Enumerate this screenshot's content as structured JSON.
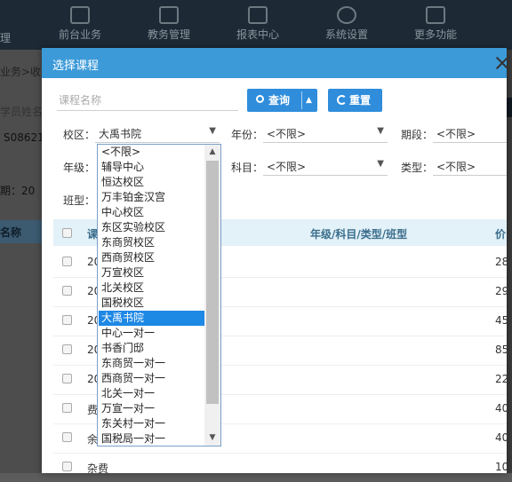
{
  "nav": {
    "left_partial": "理",
    "items": [
      {
        "label": "前台业务",
        "icon": "monitor-icon"
      },
      {
        "label": "教务管理",
        "icon": "archive-icon"
      },
      {
        "label": "报表中心",
        "icon": "chart-icon"
      },
      {
        "label": "系统设置",
        "icon": "gear-icon"
      },
      {
        "label": "更多功能",
        "icon": "grid-icon"
      }
    ]
  },
  "background": {
    "breadcrumb": "业务>收",
    "search_hint": "学员姓名",
    "code": "S08621",
    "period": "期：20",
    "name_header": "名称"
  },
  "dialog": {
    "title": "选择课程",
    "search_placeholder": "课程名称",
    "query_label": "查询",
    "reset_label": "重置",
    "filters": {
      "campus_label": "校区：",
      "campus_value": "大禹书院",
      "year_label": "年份：",
      "year_value": "<不限>",
      "period_label": "期段：",
      "period_value": "<不限>",
      "grade_label": "年级：",
      "subject_label": "科目：",
      "subject_value": "<不限>",
      "type_label": "类型：",
      "type_value": "<不限>",
      "class_type_label": "班型："
    },
    "table": {
      "headers": [
        "课",
        "年级/科目/类型/班型",
        "价"
      ],
      "rows": [
        {
          "c1": "20",
          "c2": "28"
        },
        {
          "c1": "20",
          "c2": "29"
        },
        {
          "c1": "20",
          "c2": "45"
        },
        {
          "c1": "20",
          "c2": "85"
        },
        {
          "c1": "20",
          "c2": "22"
        },
        {
          "c1": "费",
          "c2": "40"
        },
        {
          "c1": "余",
          "c2": "40"
        },
        {
          "c1": "杂费",
          "c2": "10"
        }
      ]
    },
    "campus_options": [
      "<不限>",
      "辅导中心",
      "恒达校区",
      "万丰铂金汉宫",
      "中心校区",
      "东区实验校区",
      "东商贸校区",
      "西商贸校区",
      "万宣校区",
      "北关校区",
      "国税校区",
      "大禹书院",
      "中心一对一",
      "书香门邸",
      "东商贸一对一",
      "西商贸一对一",
      "北关一对一",
      "万宣一对一",
      "东关村一对一",
      "国税局一对一"
    ],
    "campus_selected_index": 11
  }
}
